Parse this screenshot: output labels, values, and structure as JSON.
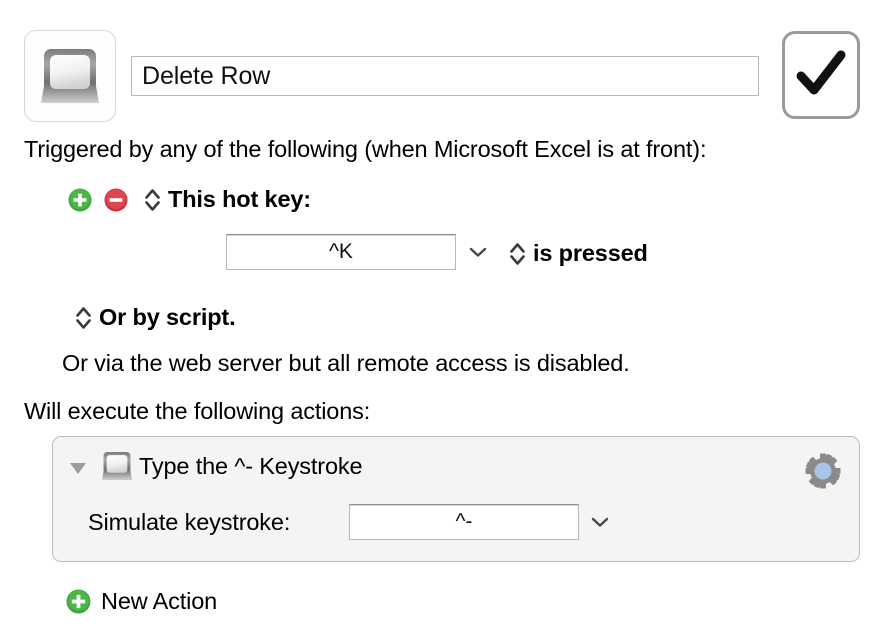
{
  "macro": {
    "icon": "keycap-icon",
    "name_value": "Delete Row",
    "name_placeholder": "Macro Name",
    "enabled_icon": "checkmark-icon"
  },
  "triggers": {
    "heading": "Triggered by any of the following (when Microsoft Excel is at front):",
    "add_icon": "plus-circle-icon",
    "remove_icon": "minus-circle-icon",
    "stepper_icon": "up-down-stepper-icon",
    "hotkey_label": "This hot key:",
    "hotkey_value": "^K",
    "hotkey_dropdown_icon": "chevron-down-icon",
    "pressed_label": "is pressed",
    "script_label": "Or by script.",
    "webserver_note": "Or via the web server but all remote access is disabled."
  },
  "actions": {
    "heading": "Will execute the following actions:",
    "disclosure_icon": "disclosure-triangle-down-icon",
    "items": [
      {
        "icon": "keycap-icon",
        "title": "Type the ^- Keystroke",
        "gear_icon": "gear-icon",
        "field_label": "Simulate keystroke:",
        "field_value": "^-",
        "field_dropdown_icon": "chevron-down-icon"
      }
    ],
    "new_action_icon": "plus-circle-icon",
    "new_action_label": "New Action"
  },
  "colors": {
    "add_green": "#3fa33f",
    "remove_red": "#df4049",
    "gear_gray": "#8a8a8a",
    "gear_center_blue": "#a8c4e8",
    "panel_bg": "#f4f4f4",
    "panel_border": "#bdbdbd",
    "field_border": "#b9b9b9"
  }
}
